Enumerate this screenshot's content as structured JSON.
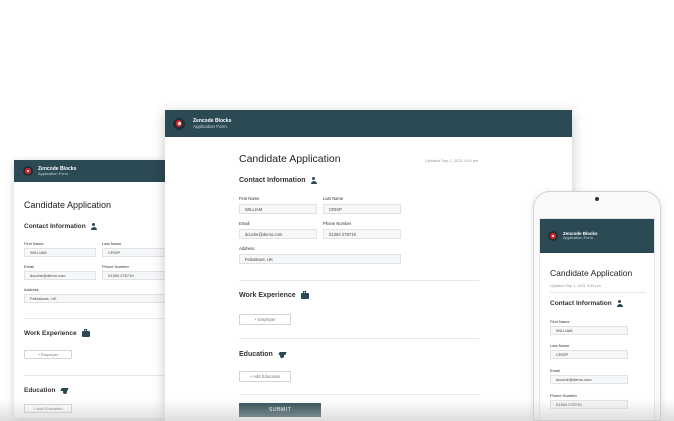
{
  "brand": {
    "name": "Zencode Blocks",
    "subtitle": "Application Form"
  },
  "form": {
    "title": "Candidate Application",
    "updated": "Updated Sep 1, 2021 3:44 pm",
    "contact_section": "Contact Information",
    "work_section": "Work Experience",
    "education_section": "Education",
    "fields": {
      "first_name": {
        "label": "First Name",
        "value": "WILLIAM"
      },
      "last_name": {
        "label": "Last Name",
        "value": "CRISP"
      },
      "email": {
        "label": "Email",
        "value": "dcuche@demo.com"
      },
      "phone": {
        "label": "Phone Number",
        "value": "01394 279719"
      },
      "address": {
        "label": "Address",
        "value": "Felixstowe, UK"
      }
    },
    "add_employer": "+ Employer",
    "add_education": "+ Add Education",
    "submit": "SUBMIT"
  },
  "colors": {
    "header": "#2c4a54",
    "submit": "#2c4a54",
    "logo_red": "#d8242b"
  }
}
